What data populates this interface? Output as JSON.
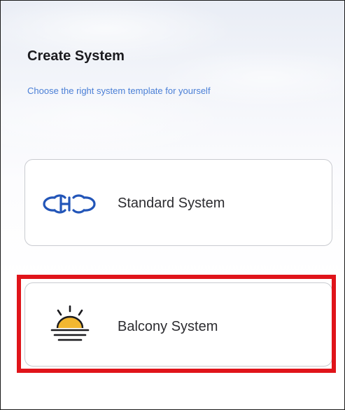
{
  "header": {
    "title": "Create System",
    "subtitle": "Choose the right system template for yourself"
  },
  "options": [
    {
      "label": "Standard System",
      "icon": "hoymiles-logo-icon",
      "color": "#2255b8"
    },
    {
      "label": "Balcony System",
      "icon": "sunrise-icon",
      "color": "#f2b731"
    }
  ],
  "highlight": {
    "target": "Balcony System",
    "color": "#e0141a"
  }
}
